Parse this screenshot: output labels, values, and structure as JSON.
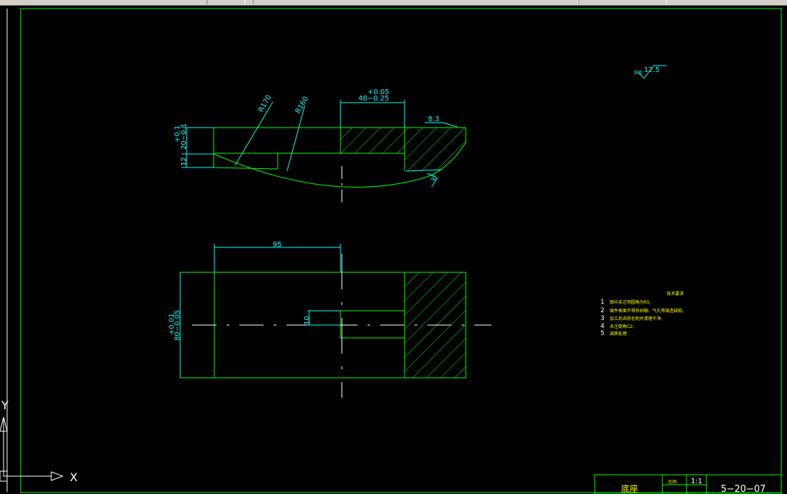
{
  "app": {
    "viewport": "model-space drawing canvas"
  },
  "colors": {
    "background": "#000000",
    "outline": "#00ff00",
    "dimension": "#00ffff",
    "centerline": "#ffffff",
    "notes": "#ffff00"
  },
  "roughness": {
    "value": "12.5",
    "prefix": "其余"
  },
  "top_view": {
    "dim_width_tol": "+0.05",
    "dim_width": "48−0.25",
    "radius_large": "R170",
    "radius_small": "R160",
    "chamfer": "8.3",
    "height_tol": "+0.1",
    "height": "20−0.1",
    "lower_height": "12",
    "angle_note": "3°"
  },
  "front_view": {
    "dim_length": "95",
    "height_tol": "+0.01",
    "height": "80−0.05",
    "slot": "10"
  },
  "notes": {
    "title": "技术要求",
    "items": [
      {
        "num": "1",
        "text": "图中未注明圆角为R5;"
      },
      {
        "num": "2",
        "text": "铸件表面不得有砂眼、气孔等铸造缺陷;"
      },
      {
        "num": "3",
        "text": "加工后去除毛刺并清理干净;"
      },
      {
        "num": "4",
        "text": "未注倒角C2;"
      },
      {
        "num": "5",
        "text": "调质处理"
      }
    ]
  },
  "ucs": {
    "y_label": "Y",
    "x_label": "X"
  },
  "title_block": {
    "part_name": "底座",
    "scale_label": "比例",
    "scale": "1:1",
    "drawing_number": "5−20−07"
  }
}
